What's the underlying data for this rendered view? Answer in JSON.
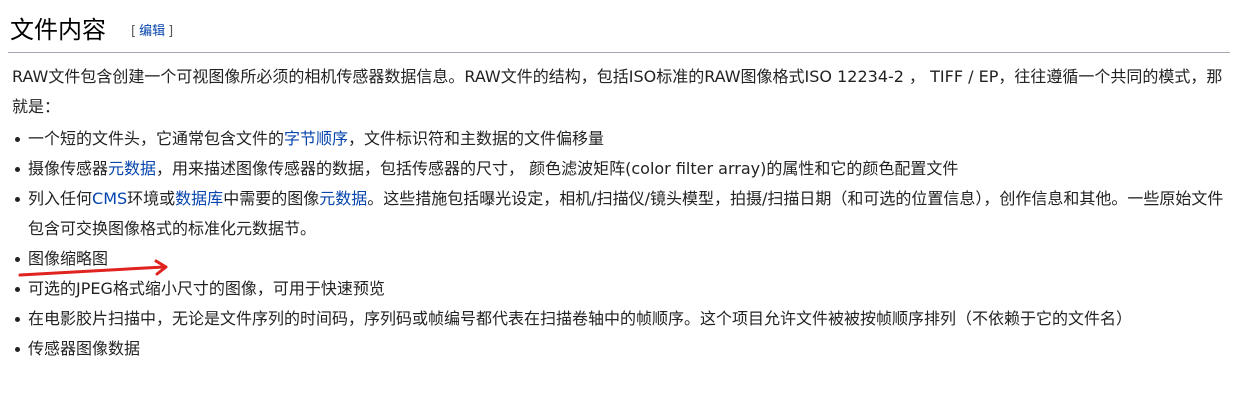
{
  "section": {
    "title": "文件内容",
    "edit_open": "[",
    "edit_label": "编辑",
    "edit_close": "]"
  },
  "intro": "RAW文件包含创建一个可视图像所必须的相机传感器数据信息。RAW文件的结构，包括ISO标准的RAW图像格式ISO 12234-2 ， TIFF / EP，往往遵循一个共同的模式，那就是：",
  "items": [
    {
      "a": "一个短的文件头，它通常包含文件的",
      "l1": "字节顺序",
      "b": "，文件标识符和主数据的文件偏移量"
    },
    {
      "a": "摄像传感器",
      "l1": "元数据",
      "b": "，用来描述图像传感器的数据，包括传感器的尺寸， 颜色滤波矩阵(color filter array)的属性和它的颜色配置文件"
    },
    {
      "a": "列入任何",
      "l1": "CMS",
      "b": "环境或",
      "l2": "数据库",
      "c": "中需要的图像",
      "l3": "元数据",
      "d": "。这些措施包括曝光设定，相机/扫描仪/镜头模型，拍摄/扫描日期（和可选的位置信息），创作信息和其他。一些原始文件包含可交换图像格式的标准化元数据节。"
    },
    {
      "a": "图像缩略图"
    },
    {
      "a": "可选的JPEG格式缩小尺寸的图像，可用于快速预览"
    },
    {
      "a": "在电影胶片扫描中，无论是文件序列的时间码，序列码或帧编号都代表在扫描卷轴中的帧顺序。这个项目允许文件被被按帧顺序排列（不依赖于它的文件名）"
    },
    {
      "a": "传感器图像数据"
    }
  ],
  "colors": {
    "link": "#0645ad",
    "text": "#222222",
    "annotation_arrow": "#e0231f"
  }
}
